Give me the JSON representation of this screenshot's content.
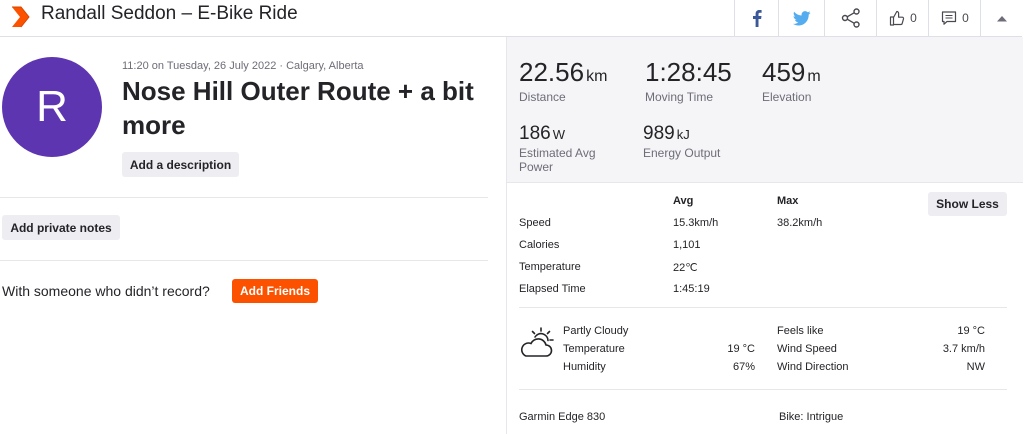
{
  "header": {
    "title": "Randall Seddon – E-Bike Ride",
    "kudos_count": "0",
    "comment_count": "0",
    "brand_color": "#fc5200",
    "facebook_color": "#3b5998",
    "twitter_color": "#55acee"
  },
  "athlete": {
    "avatar_initial": "R",
    "avatar_color": "#5e35b1"
  },
  "activity": {
    "meta": "11:20 on Tuesday, 26 July 2022 · Calgary, Alberta",
    "title": "Nose Hill Outer Route + a bit more",
    "add_description_label": "Add a description",
    "private_notes_label": "Add private notes",
    "friends_prompt": "With someone who didn’t record?",
    "add_friends_label": "Add Friends"
  },
  "stats": {
    "distance": {
      "value": "22.56",
      "unit": "km",
      "label": "Distance"
    },
    "moving_time": {
      "value": "1:28:45",
      "label": "Moving Time"
    },
    "elevation": {
      "value": "459",
      "unit": "m",
      "label": "Elevation"
    },
    "power": {
      "value": "186",
      "unit": "W",
      "label": "Estimated Avg Power"
    },
    "energy": {
      "value": "989",
      "unit": "kJ",
      "label": "Energy Output"
    }
  },
  "details": {
    "col_avg": "Avg",
    "col_max": "Max",
    "show_less_label": "Show Less",
    "rows": [
      {
        "label": "Speed",
        "avg": "15.3km/h",
        "max": "38.2km/h"
      },
      {
        "label": "Calories",
        "avg": "1,101",
        "max": ""
      },
      {
        "label": "Temperature",
        "avg": "22℃",
        "max": ""
      },
      {
        "label": "Elapsed Time",
        "avg": "1:45:19",
        "max": ""
      }
    ]
  },
  "weather": {
    "condition": "Partly Cloudy",
    "temperature_label": "Temperature",
    "temperature_value": "19 °C",
    "humidity_label": "Humidity",
    "humidity_value": "67%",
    "feels_like_label": "Feels like",
    "feels_like_value": "19 °C",
    "wind_speed_label": "Wind Speed",
    "wind_speed_value": "3.7 km/h",
    "wind_direction_label": "Wind Direction",
    "wind_direction_value": "NW"
  },
  "gear": {
    "device": "Garmin Edge 830",
    "bike": "Bike: Intrigue"
  }
}
